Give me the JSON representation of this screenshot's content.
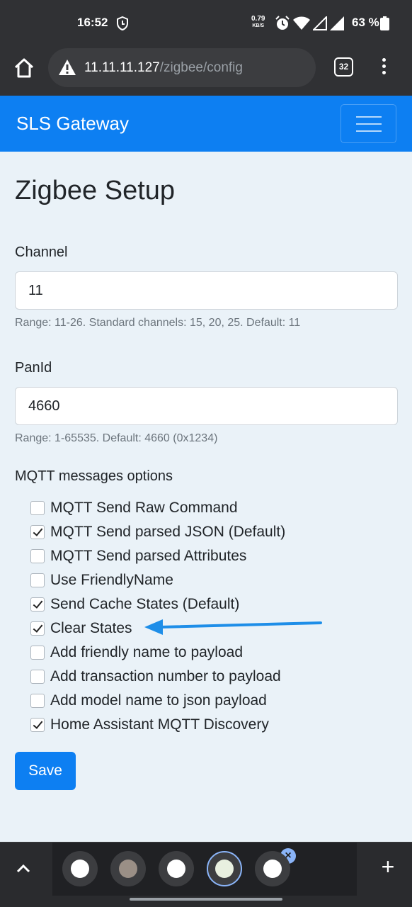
{
  "status_bar": {
    "time": "16:52",
    "speed_value": "0.79",
    "speed_unit": "KB/S",
    "battery": "63 %"
  },
  "browser": {
    "url_host": "11.11.11.127",
    "url_path": "/zigbee/config",
    "tab_count": "32"
  },
  "navbar": {
    "brand": "SLS Gateway"
  },
  "page": {
    "title": "Zigbee Setup",
    "channel": {
      "label": "Channel",
      "value": "11",
      "help": "Range: 11-26. Standard channels: 15, 20, 25. Default: 11"
    },
    "panid": {
      "label": "PanId",
      "value": "4660",
      "help": "Range: 1-65535. Default: 4660 (0x1234)"
    },
    "mqtt_options": {
      "label": "MQTT messages options",
      "items": [
        {
          "label": "MQTT Send Raw Command",
          "checked": false
        },
        {
          "label": "MQTT Send parsed JSON (Default)",
          "checked": true
        },
        {
          "label": "MQTT Send parsed Attributes",
          "checked": false
        },
        {
          "label": "Use FriendlyName",
          "checked": false
        },
        {
          "label": "Send Cache States (Default)",
          "checked": true
        },
        {
          "label": "Clear States",
          "checked": true
        },
        {
          "label": "Add friendly name to payload",
          "checked": false
        },
        {
          "label": "Add transaction number to payload",
          "checked": false
        },
        {
          "label": "Add model name to json payload",
          "checked": false
        },
        {
          "label": "Home Assistant MQTT Discovery",
          "checked": true
        }
      ]
    },
    "save_label": "Save"
  },
  "colors": {
    "accent": "#0d7ff2",
    "annotation_arrow": "#1e8ee8"
  }
}
